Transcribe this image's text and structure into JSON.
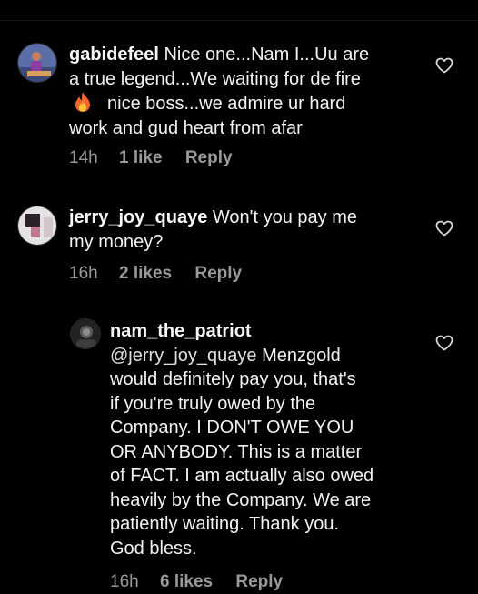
{
  "comments": [
    {
      "username": "gabidefeel",
      "line1": "Nice one...Nam I...Uu are",
      "line2": "a true legend...We waiting for de fire",
      "line3": "nice boss...we admire ur hard",
      "line4": "work and gud heart from afar",
      "time": "14h",
      "likes": "1 like",
      "reply": "Reply"
    },
    {
      "username": "jerry_joy_quaye",
      "line1": "Won't you pay me",
      "line2": "my money?",
      "time": "16h",
      "likes": "2 likes",
      "reply": "Reply"
    },
    {
      "username": "nam_the_patriot",
      "mention": "@jerry_joy_quaye",
      "line1": "Menzgold",
      "line2": "would definitely pay you, that's",
      "line3": "if you're truly owed by the",
      "line4": "Company. I DON'T OWE YOU",
      "line5": "OR ANYBODY. This is a matter",
      "line6": "of FACT. I am actually also owed",
      "line7": "heavily by the Company. We are",
      "line8": "patiently waiting. Thank you.",
      "line9": "God bless.",
      "time": "16h",
      "likes": "6 likes",
      "reply": "Reply"
    }
  ],
  "icons": {
    "heart": "heart-outline-icon",
    "fire": "fire-emoji-icon"
  },
  "colors": {
    "background": "#000000",
    "text": "#f2f2f2",
    "meta": "#9a9a9a"
  }
}
